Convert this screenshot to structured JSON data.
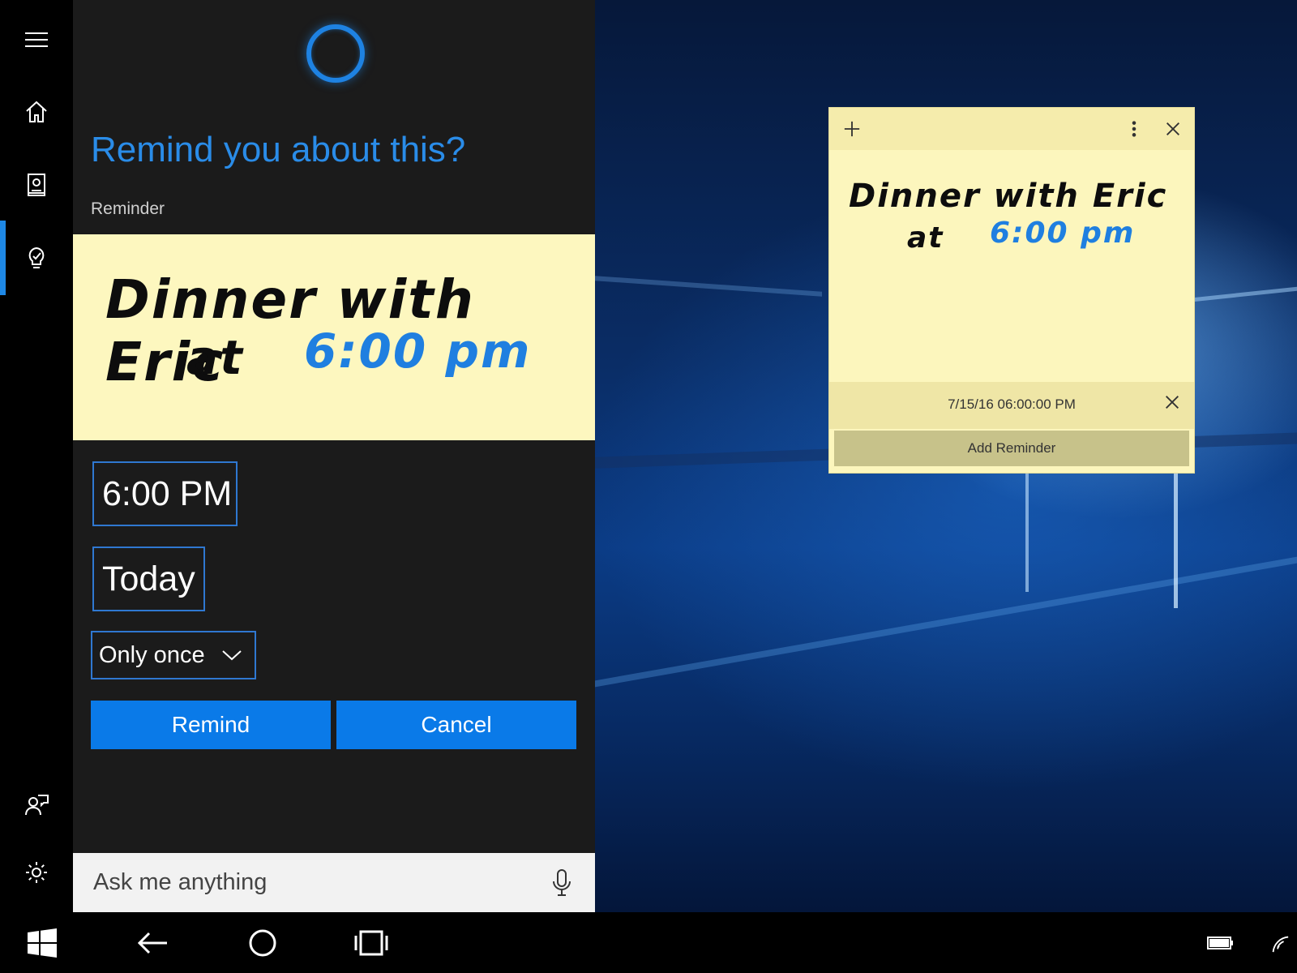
{
  "cortana": {
    "title": "Remind you about this?",
    "section_label": "Reminder",
    "note": {
      "line1": "Dinner with Eric",
      "line2_prefix": "at",
      "line2_time": "6:00 pm"
    },
    "time_value": "6:00 PM",
    "day_value": "Today",
    "repeat_value": "Only once",
    "remind_label": "Remind",
    "cancel_label": "Cancel",
    "search_placeholder": "Ask me anything"
  },
  "sticky_note": {
    "line1": "Dinner with Eric",
    "line2_prefix": "at",
    "line2_time": "6:00 pm",
    "reminder_datetime": "7/15/16 06:00:00 PM",
    "add_reminder_label": "Add Reminder"
  },
  "rail": {
    "items": [
      "menu-icon",
      "home-icon",
      "notebook-icon",
      "reminders-icon",
      "feedback-icon",
      "settings-icon"
    ],
    "active": "reminders-icon"
  },
  "taskbar": {
    "items": [
      "windows-start-icon",
      "back-icon",
      "cortana-circle-icon",
      "task-view-icon",
      "battery-icon",
      "wifi-icon"
    ]
  },
  "colors": {
    "accent": "#0a7ae8",
    "title_blue": "#2a8ce8",
    "note_yellow": "#fdf7bf",
    "panel_bg": "#1b1b1b"
  }
}
